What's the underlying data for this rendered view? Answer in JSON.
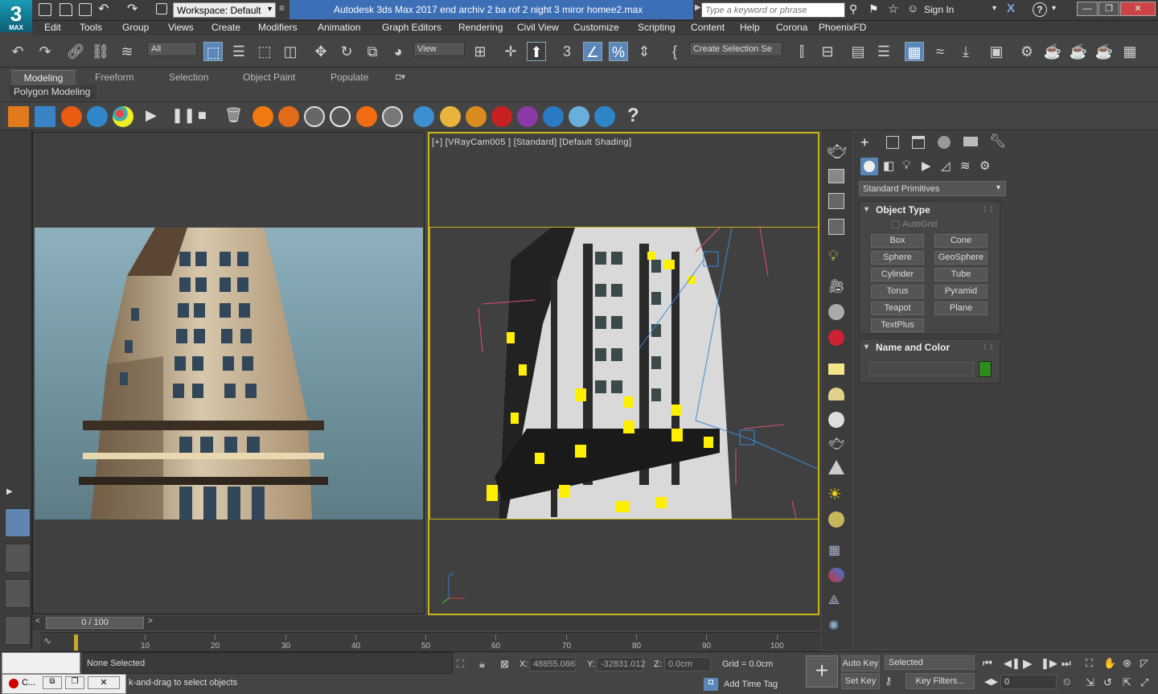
{
  "title": {
    "app_logo": "3",
    "app_logo_sub": "MAX",
    "workspace": "Workspace: Default",
    "window_title": "Autodesk 3ds Max 2017     end archiv 2 ba rof 2 night 3 miror homee2.max",
    "search_placeholder": "Type a keyword or phrase",
    "sign_in": "Sign In"
  },
  "menu": [
    "Edit",
    "Tools",
    "Group",
    "Views",
    "Create",
    "Modifiers",
    "Animation",
    "Graph Editors",
    "Rendering",
    "Civil View",
    "Customize",
    "Scripting",
    "Content",
    "Help",
    "Corona",
    "PhoenixFD"
  ],
  "toolbar": {
    "filter": "All",
    "ref_coord": "View",
    "selection_set": "Create Selection Se"
  },
  "ribbon": {
    "tabs": [
      "Modeling",
      "Freeform",
      "Selection",
      "Object Paint",
      "Populate"
    ],
    "active": "Modeling",
    "panel": "Polygon Modeling"
  },
  "viewport": {
    "label": "[+] [VRayCam005 ] [Standard] [Default Shading]"
  },
  "command_panel": {
    "category": "Standard Primitives",
    "object_type_title": "Object Type",
    "autogrid": "AutoGrid",
    "buttons": [
      "Box",
      "Cone",
      "Sphere",
      "GeoSphere",
      "Cylinder",
      "Tube",
      "Torus",
      "Pyramid",
      "Teapot",
      "Plane",
      "TextPlus"
    ],
    "name_color_title": "Name and Color",
    "color": "#2e8b1e"
  },
  "timeline": {
    "frame": "0 / 100",
    "ticks": [
      "10",
      "20",
      "30",
      "40",
      "50",
      "60",
      "70",
      "80",
      "90",
      "100"
    ]
  },
  "status": {
    "selection": "None Selected",
    "prompt": "k-and-drag to select objects",
    "x_label": "X:",
    "x_value": "48855.086",
    "y_label": "Y:",
    "y_value": "-32831.012",
    "z_label": "Z:",
    "z_value": "0.0cm",
    "grid": "Grid = 0.0cm",
    "add_time_tag": "Add Time Tag",
    "auto_key": "Auto Key",
    "set_key": "Set Key",
    "selected_dropdown": "Selected",
    "key_filters": "Key Filters...",
    "frame_field": "0",
    "taskbar_item": "C..."
  }
}
